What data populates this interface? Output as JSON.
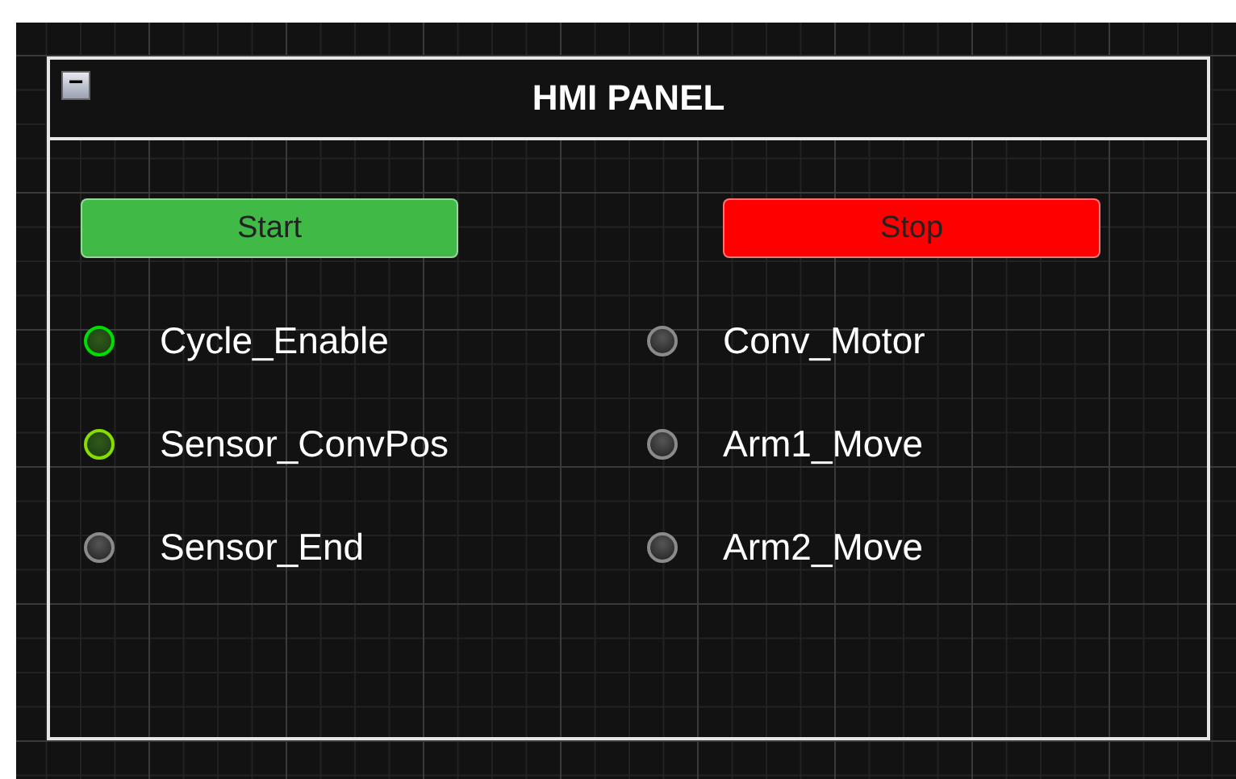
{
  "panel": {
    "title": "HMI PANEL",
    "collapse_icon": "−"
  },
  "buttons": [
    {
      "label": "Start",
      "color": "#41b947"
    },
    {
      "label": "Stop",
      "color": "#ff0000"
    }
  ],
  "lamps": [
    [
      {
        "label": "Cycle_Enable",
        "on": true,
        "color": "#00dd00"
      },
      {
        "label": "Sensor_ConvPos",
        "on": true,
        "color": "#88dd00"
      },
      {
        "label": "Sensor_End",
        "on": false
      }
    ],
    [
      {
        "label": "Conv_Motor",
        "on": false
      },
      {
        "label": "Arm1_Move",
        "on": false
      },
      {
        "label": "Arm2_Move",
        "on": false
      }
    ]
  ]
}
